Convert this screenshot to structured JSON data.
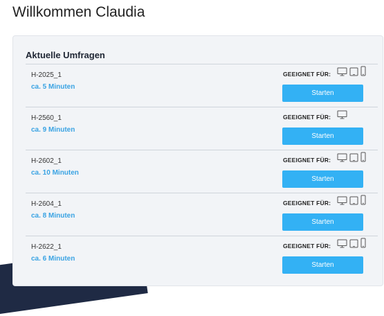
{
  "header": {
    "welcome": "Willkommen Claudia"
  },
  "surveys": {
    "title": "Aktuelle Umfragen",
    "suitable_label": "GEEIGNET FÜR:",
    "start_label": "Starten",
    "items": [
      {
        "id": "H-2025_1",
        "duration": "ca. 5 Minuten",
        "devices": [
          "desktop-icon",
          "tablet-icon",
          "phone-icon"
        ]
      },
      {
        "id": "H-2560_1",
        "duration": "ca. 9 Minuten",
        "devices": [
          "desktop-icon"
        ]
      },
      {
        "id": "H-2602_1",
        "duration": "ca. 10 Minuten",
        "devices": [
          "desktop-icon",
          "tablet-icon",
          "phone-icon"
        ]
      },
      {
        "id": "H-2604_1",
        "duration": "ca. 8 Minuten",
        "devices": [
          "desktop-icon",
          "tablet-icon",
          "phone-icon"
        ]
      },
      {
        "id": "H-2622_1",
        "duration": "ca. 6 Minuten",
        "devices": [
          "desktop-icon",
          "tablet-icon",
          "phone-icon"
        ]
      }
    ]
  },
  "colors": {
    "accent": "#33b1f4",
    "duration_text": "#3aa3e3",
    "card_bg": "#f2f4f7"
  }
}
